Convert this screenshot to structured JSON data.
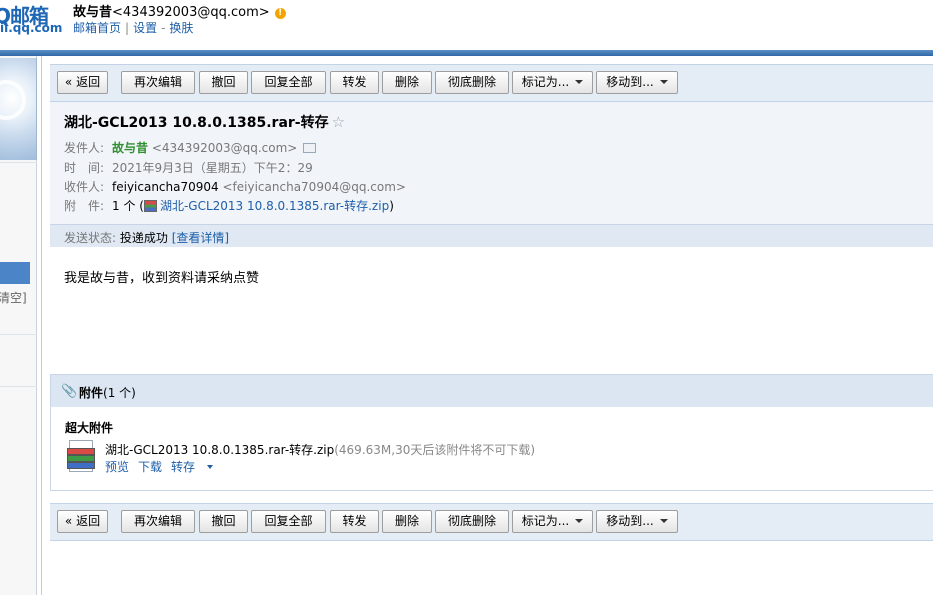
{
  "header": {
    "logo_text": "Q邮箱",
    "logo_sub": "il.qq.com",
    "user_name": "故与昔",
    "user_email": "<434392003@qq.com>",
    "links": [
      "邮箱首页",
      "设置",
      "换肤"
    ]
  },
  "sidebar": {
    "clear_text": "清空]"
  },
  "toolbar": {
    "back": "« 返回",
    "reedit": "再次编辑",
    "recall": "撤回",
    "reply_all": "回复全部",
    "forward": "转发",
    "delete": "删除",
    "delete_perm": "彻底删除",
    "mark_as": "标记为...",
    "move_to": "移动到..."
  },
  "mail": {
    "subject": "湖北-GCL2013 10.8.0.1385.rar-转存",
    "sender_label": "发件人:",
    "sender_name": "故与昔",
    "sender_email": "<434392003@qq.com>",
    "time_label": "时　间:",
    "time_value": "2021年9月3日（星期五）下午2：29",
    "recipient_label": "收件人:",
    "recipient_name": "feiyicancha70904",
    "recipient_email": "<feiyicancha70904@qq.com>",
    "attachment_label": "附　件:",
    "attachment_count": "1 个 (",
    "attachment_name": "湖北-GCL2013 10.8.0.1385.rar-转存.zip",
    "attachment_close": ")",
    "status_label": "发送状态:",
    "status_value": "投递成功",
    "status_link": "[查看详情]",
    "body": "我是故与昔，收到资料请采纳点赞"
  },
  "attachments": {
    "title": "附件",
    "count": "(1 个)",
    "big_label": "超大附件",
    "file_name": "湖北-GCL2013 10.8.0.1385.rar-转存.zip",
    "file_note": "(469.63M,30天后该附件将不可下载)",
    "preview": "预览",
    "download": "下载",
    "save": "转存"
  }
}
